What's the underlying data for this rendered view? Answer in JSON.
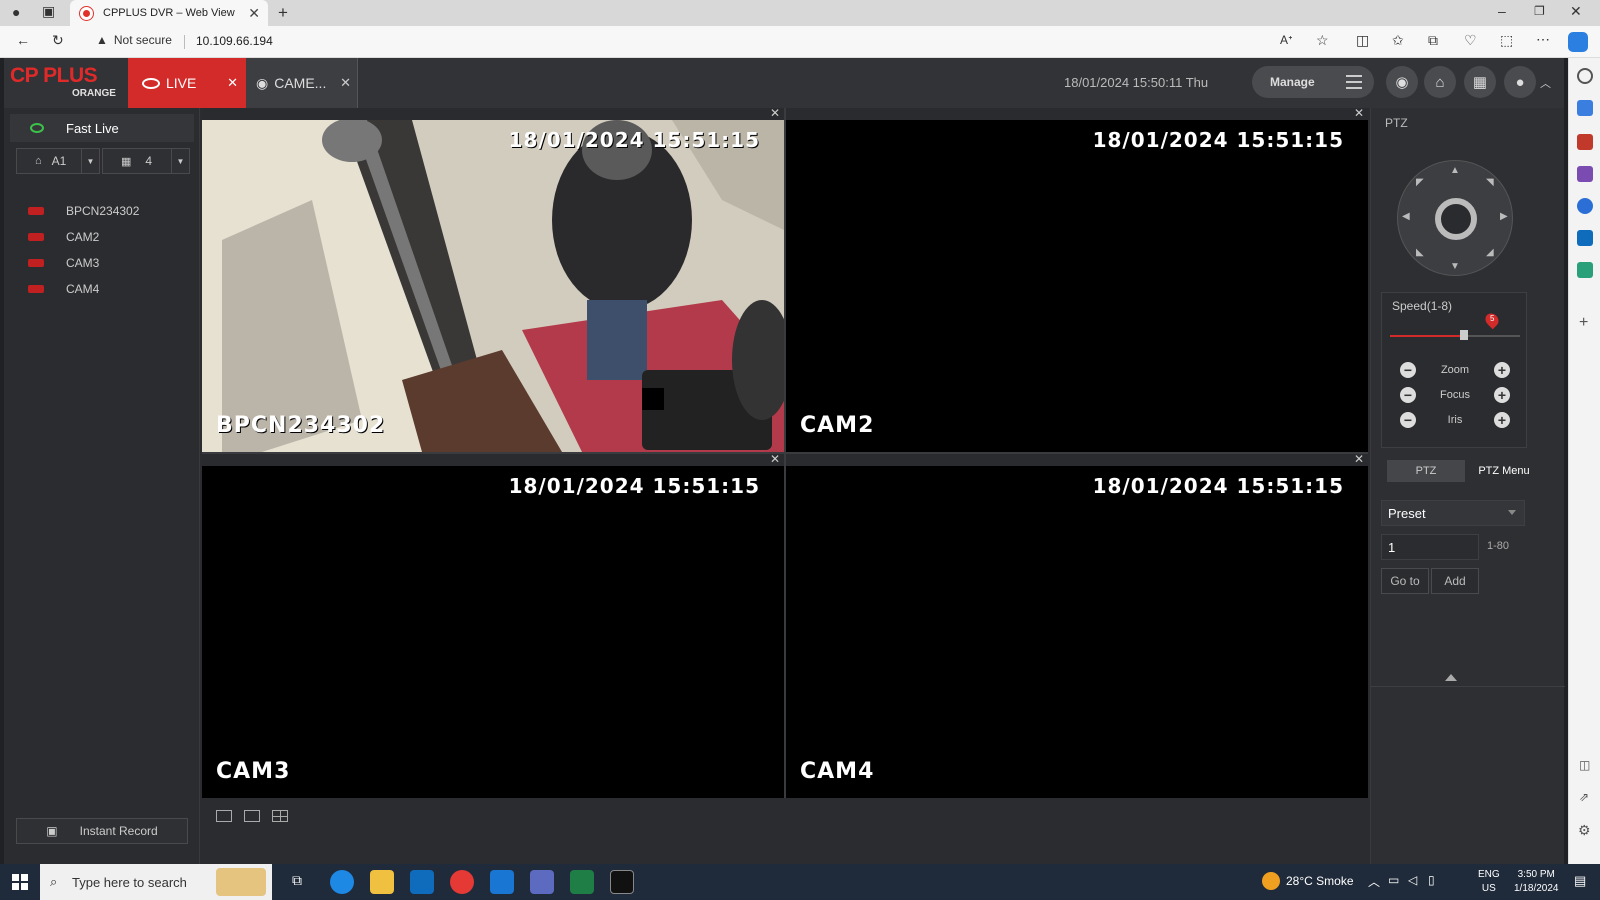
{
  "browser": {
    "tab_title": "CPPLUS DVR – Web View",
    "address_warning": "Not secure",
    "url": "10.109.66.194"
  },
  "app": {
    "logo_text": "CP PLUS",
    "logo_sub": "ORANGE",
    "tabs": [
      {
        "label": "LIVE",
        "active": true
      },
      {
        "label": "CAME...",
        "active": false
      }
    ],
    "datetime": "18/01/2024 15:50:11 Thu",
    "manage_label": "Manage"
  },
  "left_panel": {
    "fast_live": "Fast Live",
    "channel_select": "A1",
    "layout_select": "4",
    "cameras": [
      "BPCN234302",
      "CAM2",
      "CAM3",
      "CAM4"
    ],
    "instant_record": "Instant Record"
  },
  "tiles": [
    {
      "timestamp": "18/01/2024 15:51:15",
      "label": "BPCN234302",
      "has_video": true,
      "selected": true
    },
    {
      "timestamp": "18/01/2024 15:51:15",
      "label": "CAM2",
      "has_video": false,
      "selected": false
    },
    {
      "timestamp": "18/01/2024 15:51:15",
      "label": "CAM3",
      "has_video": false,
      "selected": false
    },
    {
      "timestamp": "18/01/2024 15:51:15",
      "label": "CAM4",
      "has_video": false,
      "selected": false
    }
  ],
  "ptz": {
    "title": "PTZ",
    "speed_label": "Speed(1-8)",
    "speed_value": "5",
    "speed_min": 1,
    "speed_max": 8,
    "controls": [
      "Zoom",
      "Focus",
      "Iris"
    ],
    "tab_ptz": "PTZ",
    "tab_ptz_menu": "PTZ Menu",
    "preset_select": "Preset",
    "preset_number": "1",
    "preset_range": "1-80",
    "goto_label": "Go to",
    "add_label": "Add"
  },
  "taskbar": {
    "search_placeholder": "Type here to search",
    "weather": "28°C  Smoke",
    "lang_1": "ENG",
    "lang_2": "US",
    "time": "3:50 PM",
    "date": "1/18/2024"
  },
  "colors": {
    "brand_red": "#d32a2a",
    "selection_green": "#3cc24a",
    "panel_bg": "#2b2c2f"
  }
}
